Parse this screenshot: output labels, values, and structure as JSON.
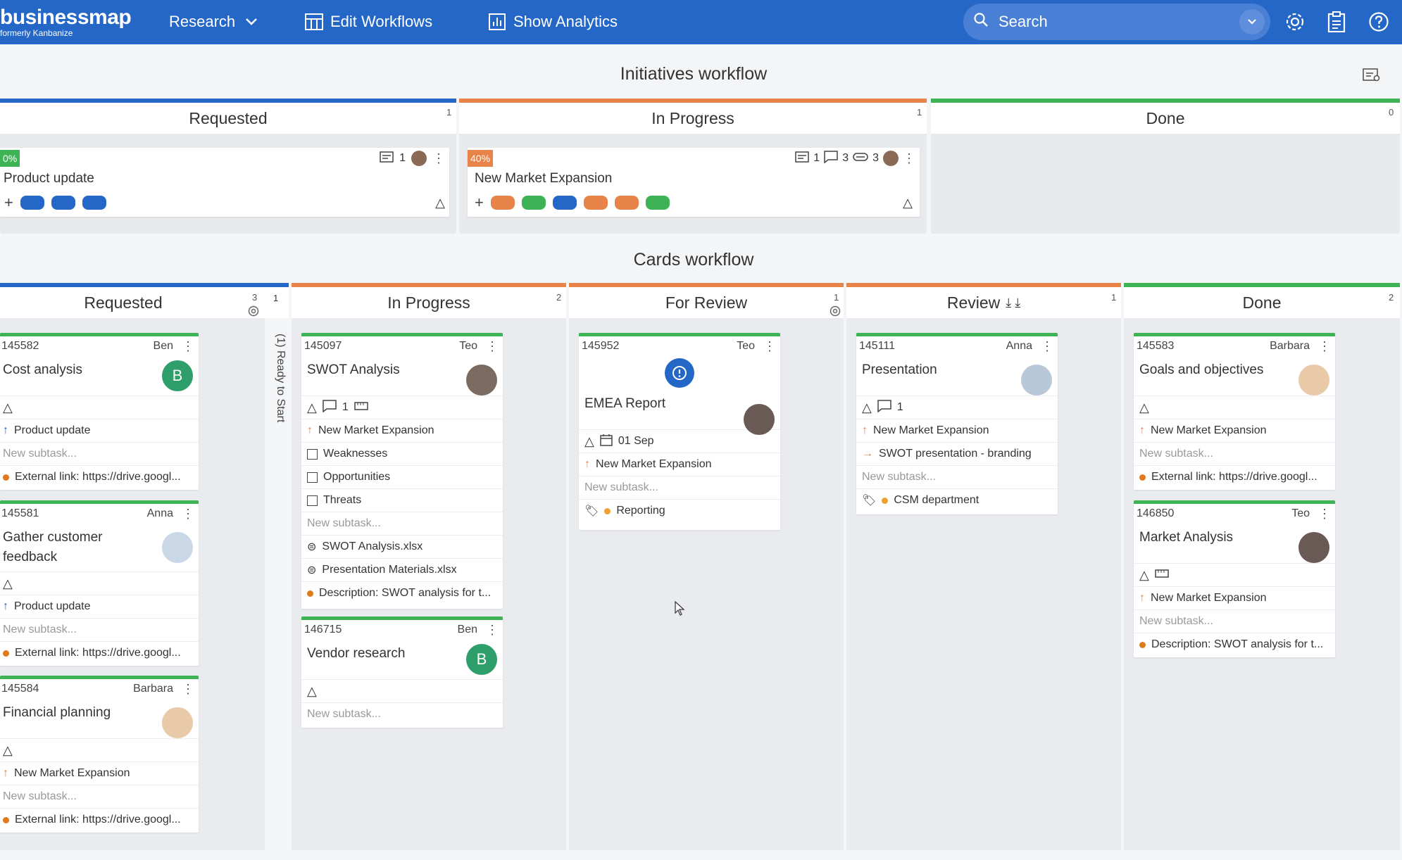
{
  "topbar": {
    "logo": "businessmap",
    "logo_sub": "formerly Kanbanize",
    "nav_research": "Research",
    "nav_edit": "Edit Workflows",
    "nav_analytics": "Show Analytics",
    "search_placeholder": "Search",
    "bg_color": "#2467c7"
  },
  "initiatives": {
    "title": "Initiatives workflow",
    "columns": [
      {
        "name": "Requested",
        "count": "1",
        "color": "#2467c7"
      },
      {
        "name": "In Progress",
        "count": "1",
        "color": "#e8844a"
      },
      {
        "name": "Done",
        "count": "0",
        "color": "#3db355"
      }
    ],
    "cards": [
      {
        "pct": "0%",
        "title": "Product update",
        "count": "1"
      },
      {
        "pct": "40%",
        "title": "New Market Expansion",
        "c1": "1",
        "c2": "3",
        "c3": "3"
      }
    ]
  },
  "cards_workflow": {
    "title": "Cards workflow",
    "ready_label": "(1) Ready to Start",
    "ready_count": "1",
    "columns": [
      {
        "name": "Requested",
        "count": "3",
        "color": "#2467c7"
      },
      {
        "name": "In Progress",
        "count": "2",
        "color": "#e8844a"
      },
      {
        "name": "For Review",
        "count": "1",
        "color": "#e8844a"
      },
      {
        "name": "Review",
        "count": "1",
        "color": "#e8844a"
      },
      {
        "name": "Done",
        "count": "2",
        "color": "#3db355"
      }
    ],
    "new_subtask": "New subtask...",
    "requested_cards": [
      {
        "id": "145582",
        "owner": "Ben",
        "title": "Cost analysis",
        "parent": "Product update",
        "link": "External link: https://drive.googl..."
      },
      {
        "id": "145581",
        "owner": "Anna",
        "title": "Gather customer feedback",
        "parent": "Product update",
        "link": "External link: https://drive.googl..."
      },
      {
        "id": "145584",
        "owner": "Barbara",
        "title": "Financial planning",
        "parent": "New Market Expansion",
        "link": "External link: https://drive.googl..."
      }
    ],
    "progress_cards": [
      {
        "id": "145097",
        "owner": "Teo",
        "title": "SWOT Analysis",
        "comments": "1",
        "parent": "New Market Expansion",
        "subtasks": [
          "Weaknesses",
          "Opportunities",
          "Threats"
        ],
        "files": [
          "SWOT Analysis.xlsx",
          "Presentation Materials.xlsx"
        ],
        "desc": "Description: SWOT analysis for t..."
      },
      {
        "id": "146715",
        "owner": "Ben",
        "title": "Vendor research"
      }
    ],
    "forreview_card": {
      "id": "145952",
      "owner": "Teo",
      "title": "EMEA Report",
      "date": "01 Sep",
      "parent": "New Market Expansion",
      "tag": "Reporting"
    },
    "review_card": {
      "id": "145111",
      "owner": "Anna",
      "title": "Presentation",
      "comments": "1",
      "parent": "New Market Expansion",
      "child": "SWOT presentation - branding",
      "tag": "CSM department"
    },
    "done_cards": [
      {
        "id": "145583",
        "owner": "Barbara",
        "title": "Goals and objectives",
        "parent": "New Market Expansion",
        "link": "External link: https://drive.googl..."
      },
      {
        "id": "146850",
        "owner": "Teo",
        "title": "Market Analysis",
        "parent": "New Market Expansion",
        "desc": "Description: SWOT analysis for t..."
      }
    ],
    "avatar_letter": "B"
  }
}
